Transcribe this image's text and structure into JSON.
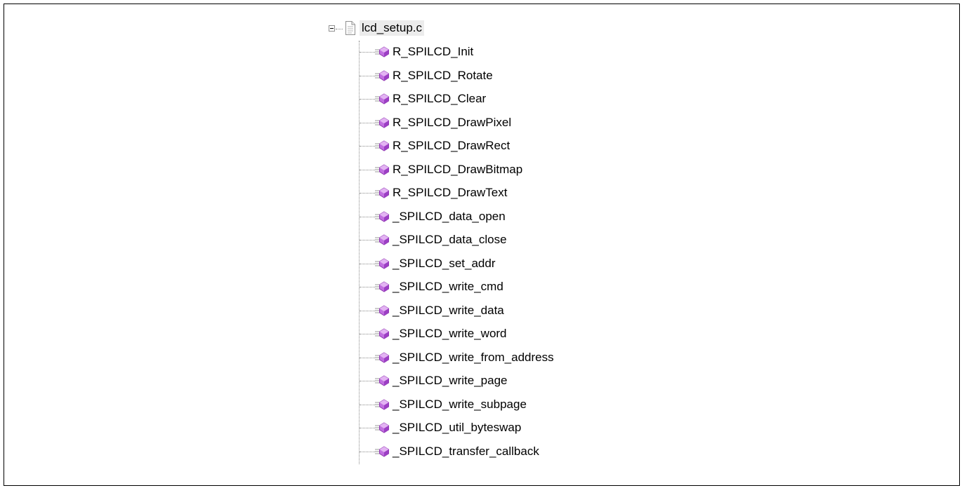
{
  "tree": {
    "root": {
      "label": "lcd_setup.c",
      "expanded": true,
      "icon": "source-file-icon",
      "toggle_icon": "collapse-minus-icon"
    },
    "member_icon": "function-member-icon",
    "member_colors": {
      "diamond": "#b44bd6",
      "lines": "#9a9a9a"
    },
    "items": [
      {
        "label": "R_SPILCD_Init"
      },
      {
        "label": "R_SPILCD_Rotate"
      },
      {
        "label": "R_SPILCD_Clear"
      },
      {
        "label": "R_SPILCD_DrawPixel"
      },
      {
        "label": "R_SPILCD_DrawRect"
      },
      {
        "label": "R_SPILCD_DrawBitmap"
      },
      {
        "label": "R_SPILCD_DrawText"
      },
      {
        "label": "_SPILCD_data_open"
      },
      {
        "label": "_SPILCD_data_close"
      },
      {
        "label": "_SPILCD_set_addr"
      },
      {
        "label": "_SPILCD_write_cmd"
      },
      {
        "label": "_SPILCD_write_data"
      },
      {
        "label": "_SPILCD_write_word"
      },
      {
        "label": "_SPILCD_write_from_address"
      },
      {
        "label": "_SPILCD_write_page"
      },
      {
        "label": "_SPILCD_write_subpage"
      },
      {
        "label": "_SPILCD_util_byteswap"
      },
      {
        "label": "_SPILCD_transfer_callback"
      }
    ]
  }
}
